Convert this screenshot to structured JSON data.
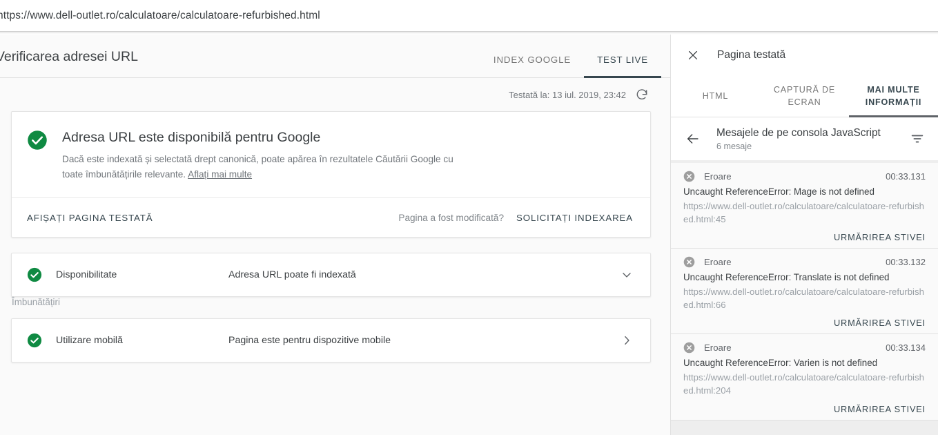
{
  "urlbar": {
    "url": "https://www.dell-outlet.ro/calculatoare/calculatoare-refurbished.html"
  },
  "left": {
    "page_title": "Verificarea adresei URL",
    "tabs": [
      {
        "label": "INDEX GOOGLE",
        "active": false
      },
      {
        "label": "TEST LIVE",
        "active": true
      }
    ],
    "tested_at": "Testată la: 13 iul. 2019, 23:42",
    "refresh_icon": "refresh-icon",
    "result_card": {
      "status_icon": "check-circle-icon",
      "heading": "Adresa URL este disponibilă pentru Google",
      "description_part1": "Dacă este indexată și selectată drept canonică, poate apărea în rezultatele Căutării Google cu toate îmbunătățirile relevante. ",
      "learn_more": "Aflați mai multe",
      "action_left": "AFIȘAȚI PAGINA TESTATĂ",
      "action_question": "Pagina a fost modificată?",
      "action_right": "SOLICITAȚI INDEXAREA"
    },
    "rows": [
      {
        "status_icon": "check-circle-icon",
        "label": "Disponibilitate",
        "value": "Adresa URL poate fi indexată",
        "chevron": "chevron-down-icon"
      }
    ],
    "section_label": "Îmbunătățiri",
    "enhancement_rows": [
      {
        "status_icon": "check-circle-icon",
        "label": "Utilizare mobilă",
        "value": "Pagina este pentru dispozitive mobile",
        "chevron": "chevron-right-icon"
      }
    ]
  },
  "right": {
    "close_icon": "close-icon",
    "title": "Pagina testată",
    "tabs": [
      {
        "label": "HTML",
        "active": false
      },
      {
        "label": "CAPTURĂ DE ECRAN",
        "active": false
      },
      {
        "label": "MAI MULTE INFORMAȚII",
        "active": true
      }
    ],
    "console": {
      "back_icon": "arrow-left-icon",
      "title": "Mesajele de pe consola JavaScript",
      "subtitle": "6 mesaje",
      "filter_icon": "filter-icon",
      "messages": [
        {
          "severity_icon": "error-circle-icon",
          "severity": "Eroare",
          "time": "00:33.131",
          "text": "Uncaught ReferenceError: Mage is not defined",
          "url": "https://www.dell-outlet.ro/calculatoare/calculatoare-refurbished.html:45",
          "action": "URMĂRIREA STIVEI"
        },
        {
          "severity_icon": "error-circle-icon",
          "severity": "Eroare",
          "time": "00:33.132",
          "text": "Uncaught ReferenceError: Translate is not defined",
          "url": "https://www.dell-outlet.ro/calculatoare/calculatoare-refurbished.html:66",
          "action": "URMĂRIREA STIVEI"
        },
        {
          "severity_icon": "error-circle-icon",
          "severity": "Eroare",
          "time": "00:33.134",
          "text": "Uncaught ReferenceError: Varien is not defined",
          "url": "https://www.dell-outlet.ro/calculatoare/calculatoare-refurbished.html:204",
          "action": "URMĂRIREA STIVEI"
        }
      ]
    }
  },
  "colors": {
    "success_green": "#0f8a42",
    "error_gray": "#9e9e9e",
    "accent_dark": "#37474f"
  }
}
